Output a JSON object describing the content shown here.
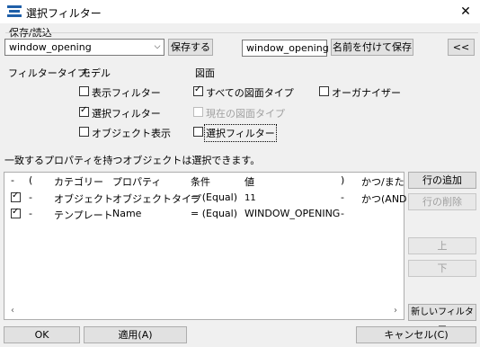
{
  "window": {
    "title": "選択フィルター",
    "close_glyph": "✕"
  },
  "save_load": {
    "group_label": "保存/読込",
    "combo_value": "window_opening",
    "save_button": "保存する",
    "name_value": "window_opening",
    "save_as_button": "名前を付けて保存",
    "collapse_button": "<<"
  },
  "filter_type": {
    "label": "フィルタータイプ:",
    "model_header": "モデル",
    "drawing_header": "図面",
    "options": {
      "display_filter": {
        "label": "表示フィルター",
        "checked": false
      },
      "selection_filter": {
        "label": "選択フィルター",
        "checked": true
      },
      "object_display": {
        "label": "オブジェクト表示",
        "checked": false
      },
      "all_drawing_types": {
        "label": "すべての図面タイプ",
        "checked": true
      },
      "current_drawing_type": {
        "label": "現在の図面タイプ",
        "checked": false,
        "disabled": true
      },
      "drawing_selection_filter": {
        "label": "選択フィルター",
        "checked": false
      },
      "organizer": {
        "label": "オーガナイザー",
        "checked": false
      }
    }
  },
  "rule_text": "一致するプロパティを持つオブジェクトは選択できます。",
  "grid": {
    "columns": [
      "-",
      "(",
      "カテゴリー",
      "プロパティ",
      "条件",
      "値",
      ")",
      "かつ/また"
    ],
    "rows": [
      {
        "checked": true,
        "dash": "-",
        "category": "オブジェクト",
        "property": "オブジェクトタイプ",
        "condition": "= (Equal)",
        "value": "11",
        "close": "-",
        "andor": "かつ(AND"
      },
      {
        "checked": true,
        "dash": "-",
        "category": "テンプレート",
        "property": "Name",
        "condition": "= (Equal)",
        "value": "WINDOW_OPENING",
        "close": "-",
        "andor": ""
      }
    ]
  },
  "side_buttons": {
    "add_row": "行の追加",
    "delete_row": "行の削除",
    "up": "上",
    "down": "下",
    "new_filter": "新しいフィルター"
  },
  "bottom_buttons": {
    "ok": "OK",
    "apply": "適用(A)",
    "cancel": "キャンセル(C)"
  }
}
